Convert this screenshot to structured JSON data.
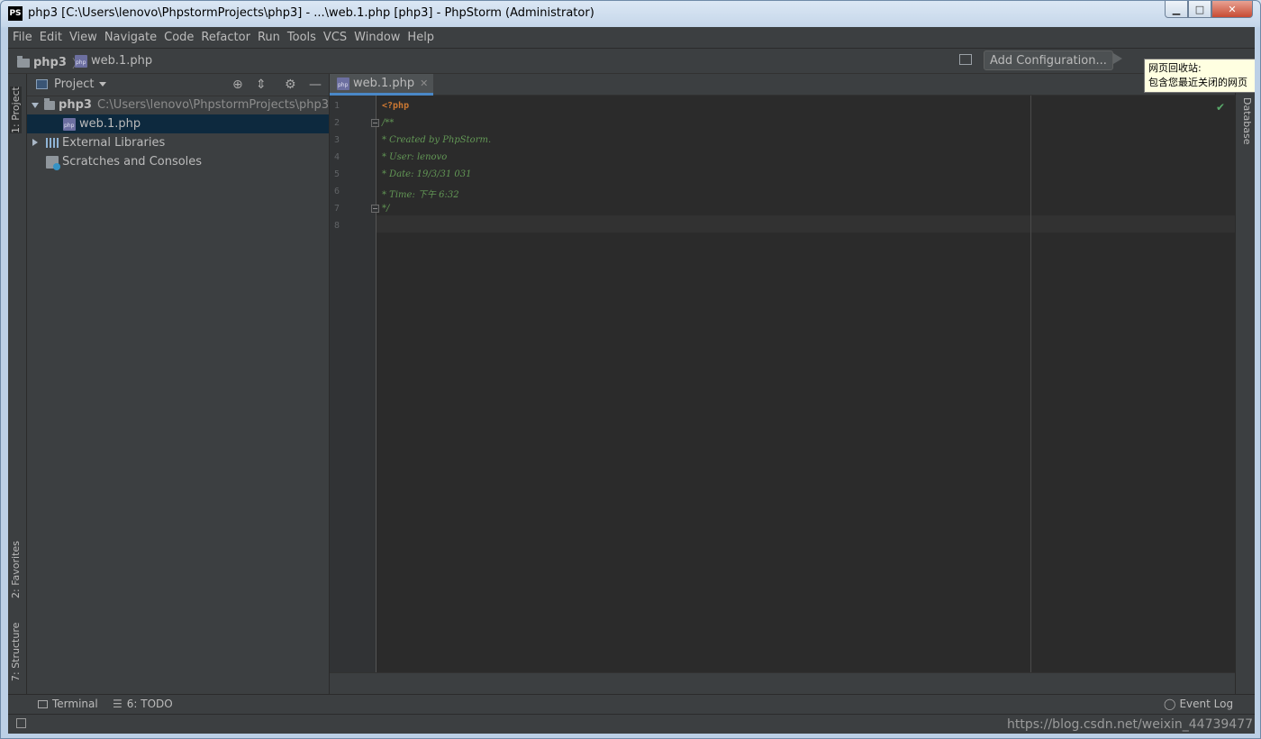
{
  "window": {
    "app_logo": "PS",
    "title": "php3 [C:\\Users\\lenovo\\PhpstormProjects\\php3] - ...\\web.1.php [php3] - PhpStorm (Administrator)",
    "controls": {
      "minimize": "▁",
      "maximize": "□",
      "close": "✕"
    }
  },
  "menu": [
    "File",
    "Edit",
    "View",
    "Navigate",
    "Code",
    "Refactor",
    "Run",
    "Tools",
    "VCS",
    "Window",
    "Help"
  ],
  "navbar": {
    "breadcrumb_project": "php3",
    "breadcrumb_file": "web.1.php",
    "add_configuration": "Add Configuration..."
  },
  "tooltip": {
    "line1": "网页回收站:",
    "line2": "包含您最近关闭的网页"
  },
  "left_tool_tabs": {
    "project": "1: Project",
    "favorites": "2: Favorites",
    "structure": "7: Structure"
  },
  "right_tool_tabs": {
    "database": "Database"
  },
  "project_panel": {
    "title": "Project",
    "tree": {
      "root_name": "php3",
      "root_path": "C:\\Users\\lenovo\\PhpstormProjects\\php3",
      "file": "web.1.php",
      "external_libraries": "External Libraries",
      "scratches": "Scratches and Consoles"
    }
  },
  "editor": {
    "tab_label": "web.1.php",
    "line_numbers": [
      "1",
      "2",
      "3",
      "4",
      "5",
      "6",
      "7",
      "8"
    ],
    "code_lines": [
      "<?php",
      "/**",
      " * Created by PhpStorm.",
      " * User: lenovo",
      " * Date: 19/3/31 031",
      " * Time: 下午 6:32",
      " */",
      ""
    ]
  },
  "bottom_tools": {
    "terminal": "Terminal",
    "todo": "6: TODO",
    "event_log": "Event Log"
  },
  "status": {
    "watermark": "https://blog.csdn.net/weixin_44739477"
  },
  "colors": {
    "keyword": "#cc7832",
    "doc_comment": "#629755",
    "editor_bg": "#2b2b2b",
    "panel_bg": "#3c3f41",
    "selection": "#0d293e",
    "tab_underline": "#4a88c7"
  }
}
